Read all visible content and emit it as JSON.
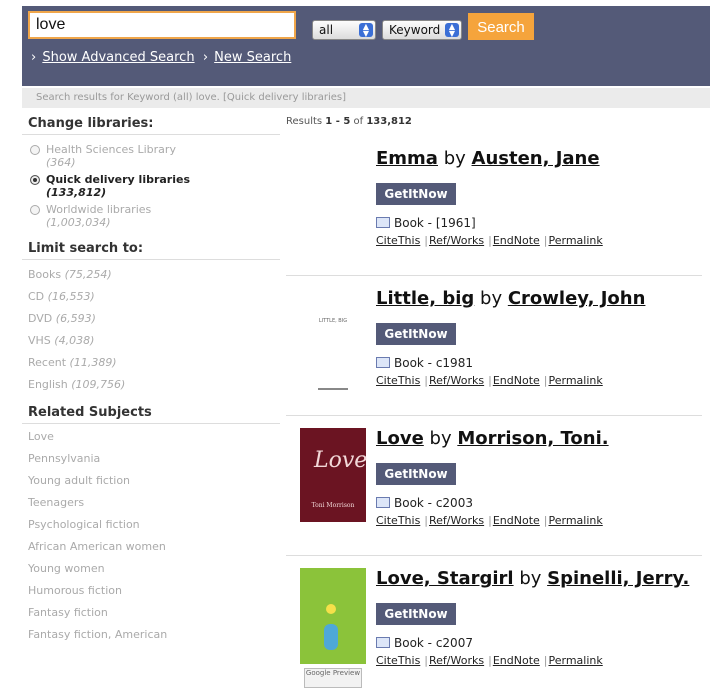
{
  "search": {
    "query": "love",
    "scope": "all",
    "type": "Keyword",
    "button": "Search"
  },
  "toplinks": {
    "advanced": "Show Advanced Search",
    "new": "New Search",
    "arrow": "›"
  },
  "status": "Search results for Keyword (all) love. [Quick delivery libraries]",
  "sidebar": {
    "change_libraries": "Change libraries:",
    "libraries": [
      {
        "label": "Health Sciences Library",
        "count": "(364)",
        "selected": false
      },
      {
        "label": "Quick delivery libraries",
        "count": "(133,812)",
        "selected": true
      },
      {
        "label": "Worldwide libraries",
        "count": "(1,003,034)",
        "selected": false
      }
    ],
    "limit_heading": "Limit search to:",
    "limits": [
      {
        "label": "Books",
        "count": "(75,254)"
      },
      {
        "label": "CD",
        "count": "(16,553)"
      },
      {
        "label": "DVD",
        "count": "(6,593)"
      },
      {
        "label": "VHS",
        "count": "(4,038)"
      },
      {
        "label": "Recent",
        "count": "(11,389)"
      },
      {
        "label": "English",
        "count": "(109,756)"
      }
    ],
    "subjects_heading": "Related Subjects",
    "subjects": [
      "Love",
      "Pennsylvania",
      "Young adult fiction",
      "Teenagers",
      "Psychological fiction",
      "African American women",
      "Young women",
      "Humorous fiction",
      "Fantasy fiction",
      "Fantasy fiction, American"
    ]
  },
  "results_count": {
    "prefix": "Results",
    "range": "1 - 5",
    "of": "of",
    "total": "133,812"
  },
  "results": [
    {
      "title": "Emma",
      "by": "by",
      "author": "Austen, Jane",
      "getit": "GetItNow",
      "format": "Book - [1961]",
      "links": [
        "CiteThis",
        "Ref/Works",
        "EndNote",
        "Permalink"
      ],
      "cover": "none"
    },
    {
      "title": "Little, big",
      "by": "by",
      "author": "Crowley, John",
      "getit": "GetItNow",
      "format": "Book - c1981",
      "links": [
        "CiteThis",
        "Ref/Works",
        "EndNote",
        "Permalink"
      ],
      "cover": "little-big",
      "cover_text": "LITTLE, BIG"
    },
    {
      "title": "Love",
      "by": "by",
      "author": "Morrison, Toni.",
      "getit": "GetItNow",
      "format": "Book - c2003",
      "links": [
        "CiteThis",
        "Ref/Works",
        "EndNote",
        "Permalink"
      ],
      "cover": "morrison",
      "cover_script": "Love",
      "cover_author": "Toni Morrison"
    },
    {
      "title": "Love, Stargirl",
      "by": "by",
      "author": "Spinelli, Jerry.",
      "getit": "GetItNow",
      "format": "Book - c2007",
      "links": [
        "CiteThis",
        "Ref/Works",
        "EndNote",
        "Permalink"
      ],
      "cover": "stargirl",
      "cover_badge": "Google Preview"
    }
  ],
  "colors": {
    "topbar": "#545a78",
    "accent": "#f5a43c"
  }
}
